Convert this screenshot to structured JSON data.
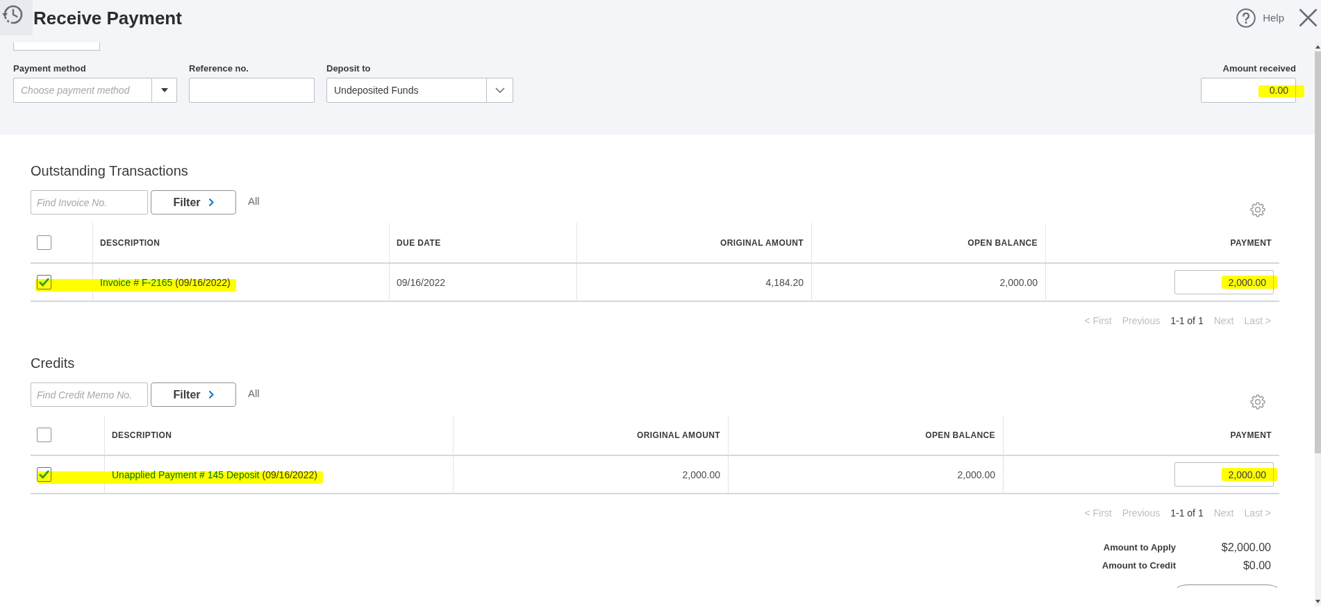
{
  "header": {
    "title": "Receive Payment",
    "help": "Help"
  },
  "form": {
    "fields": [
      {
        "kind": "dropdown",
        "label": "Payment method",
        "placeholder": "Choose payment method"
      },
      {
        "kind": "text",
        "label": "Reference no."
      },
      {
        "kind": "select",
        "label": "Deposit to",
        "value": "Undeposited Funds"
      }
    ],
    "amount_received": {
      "label": "Amount received",
      "value": "0.00",
      "highlighted": true
    }
  },
  "outstanding": {
    "title": "Outstanding Transactions",
    "search": {
      "placeholder": "Find Invoice No."
    },
    "filter_button": "Filter",
    "all_link": "All",
    "select_all": {
      "checked": false
    },
    "columns": [
      "DESCRIPTION",
      "DUE DATE",
      "ORIGINAL AMOUNT",
      "OPEN BALANCE",
      "PAYMENT"
    ],
    "rows": [
      {
        "checked": true,
        "cells": [
          {
            "kind": "description",
            "link": "Invoice # F-2165",
            "date": "(09/16/2022)",
            "highlighted": true
          },
          {
            "kind": "text",
            "text": "09/16/2022"
          },
          {
            "kind": "text",
            "text": "4,184.20"
          },
          {
            "kind": "text",
            "text": "2,000.00"
          },
          {
            "kind": "payment",
            "value": "2,000.00",
            "highlighted": true
          }
        ]
      }
    ],
    "pagination": [
      {
        "kind": "link",
        "label": "< First",
        "disabled": true
      },
      {
        "kind": "link",
        "label": "Previous",
        "disabled": true
      },
      {
        "kind": "range",
        "label": "1-1 of 1"
      },
      {
        "kind": "link",
        "label": "Next",
        "disabled": true
      },
      {
        "kind": "link",
        "label": "Last >",
        "disabled": true
      }
    ]
  },
  "credits": {
    "title": "Credits",
    "search": {
      "placeholder": "Find Credit Memo No."
    },
    "filter_button": "Filter",
    "all_link": "All",
    "select_all": {
      "checked": false
    },
    "columns": [
      "DESCRIPTION",
      "ORIGINAL AMOUNT",
      "OPEN BALANCE",
      "PAYMENT"
    ],
    "rows": [
      {
        "checked": true,
        "cells": [
          {
            "kind": "description",
            "link": "Unapplied Payment # 145 Deposit",
            "date": "(09/16/2022)",
            "highlighted": true
          },
          {
            "kind": "text",
            "text": "2,000.00"
          },
          {
            "kind": "text",
            "text": "2,000.00"
          },
          {
            "kind": "payment",
            "value": "2,000.00",
            "highlighted": true
          }
        ]
      }
    ],
    "pagination": [
      {
        "kind": "link",
        "label": "< First",
        "disabled": true
      },
      {
        "kind": "link",
        "label": "Previous",
        "disabled": true
      },
      {
        "kind": "range",
        "label": "1-1 of 1"
      },
      {
        "kind": "link",
        "label": "Next",
        "disabled": true
      },
      {
        "kind": "link",
        "label": "Last >",
        "disabled": true
      }
    ]
  },
  "totals": [
    {
      "label": "Amount to Apply",
      "value": "$2,000.00"
    },
    {
      "label": "Amount to Credit",
      "value": "$0.00"
    }
  ]
}
